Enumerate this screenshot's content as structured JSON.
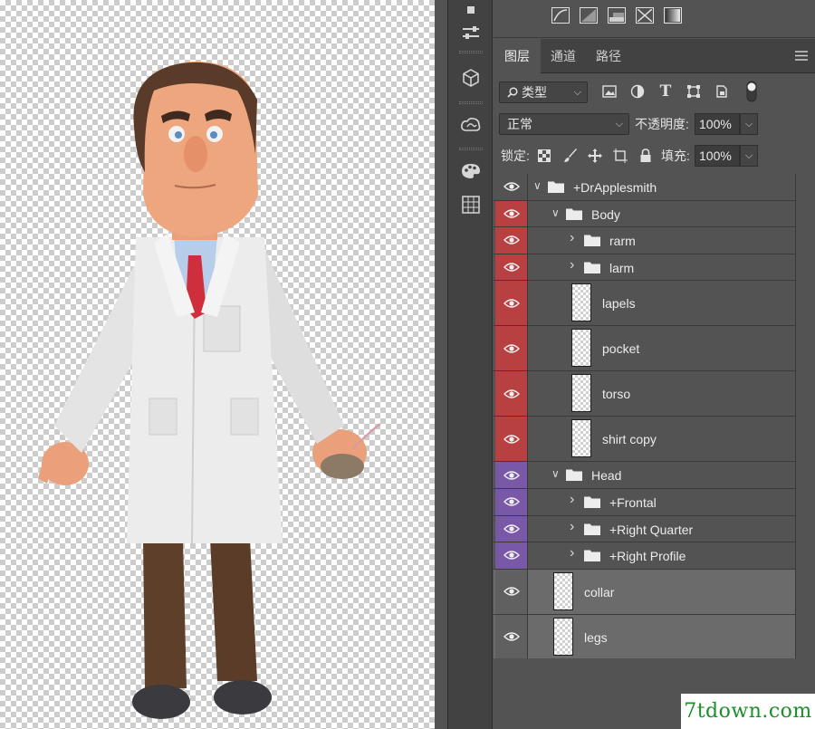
{
  "tabs": [
    {
      "label": "图层",
      "active": true
    },
    {
      "label": "通道",
      "active": false
    },
    {
      "label": "路径",
      "active": false
    }
  ],
  "filter": {
    "kind_label": "类型"
  },
  "blend": {
    "mode": "正常",
    "opacity_label": "不透明度:",
    "opacity_value": "100%"
  },
  "lock": {
    "label": "锁定:",
    "fill_label": "填充:",
    "fill_value": "100%"
  },
  "layers": [
    {
      "name": "+DrApplesmith",
      "type": "group",
      "expanded": true,
      "depth": 0,
      "color": "none"
    },
    {
      "name": "Body",
      "type": "group",
      "expanded": true,
      "depth": 1,
      "color": "red"
    },
    {
      "name": "rarm",
      "type": "group",
      "expanded": false,
      "depth": 2,
      "color": "red"
    },
    {
      "name": "larm",
      "type": "group",
      "expanded": false,
      "depth": 2,
      "color": "red"
    },
    {
      "name": "lapels",
      "type": "layer",
      "depth": 2,
      "color": "red"
    },
    {
      "name": "pocket",
      "type": "layer",
      "depth": 2,
      "color": "red"
    },
    {
      "name": "torso",
      "type": "layer",
      "depth": 2,
      "color": "red"
    },
    {
      "name": "shirt copy",
      "type": "layer",
      "depth": 2,
      "color": "red"
    },
    {
      "name": "Head",
      "type": "group",
      "expanded": true,
      "depth": 1,
      "color": "purple"
    },
    {
      "name": "+Frontal",
      "type": "group",
      "expanded": false,
      "depth": 2,
      "color": "purple"
    },
    {
      "name": "+Right Quarter",
      "type": "group",
      "expanded": false,
      "depth": 2,
      "color": "purple"
    },
    {
      "name": "+Right Profile",
      "type": "group",
      "expanded": false,
      "depth": 2,
      "color": "purple"
    },
    {
      "name": "collar",
      "type": "layer",
      "depth": 1,
      "color": "grey",
      "selected": true
    },
    {
      "name": "legs",
      "type": "layer",
      "depth": 1,
      "color": "grey",
      "selected": true
    }
  ],
  "watermark": "7tdown.com",
  "colors": {
    "red_label": "#b84040",
    "purple_label": "#7a58a8",
    "panel_bg": "#535353"
  }
}
